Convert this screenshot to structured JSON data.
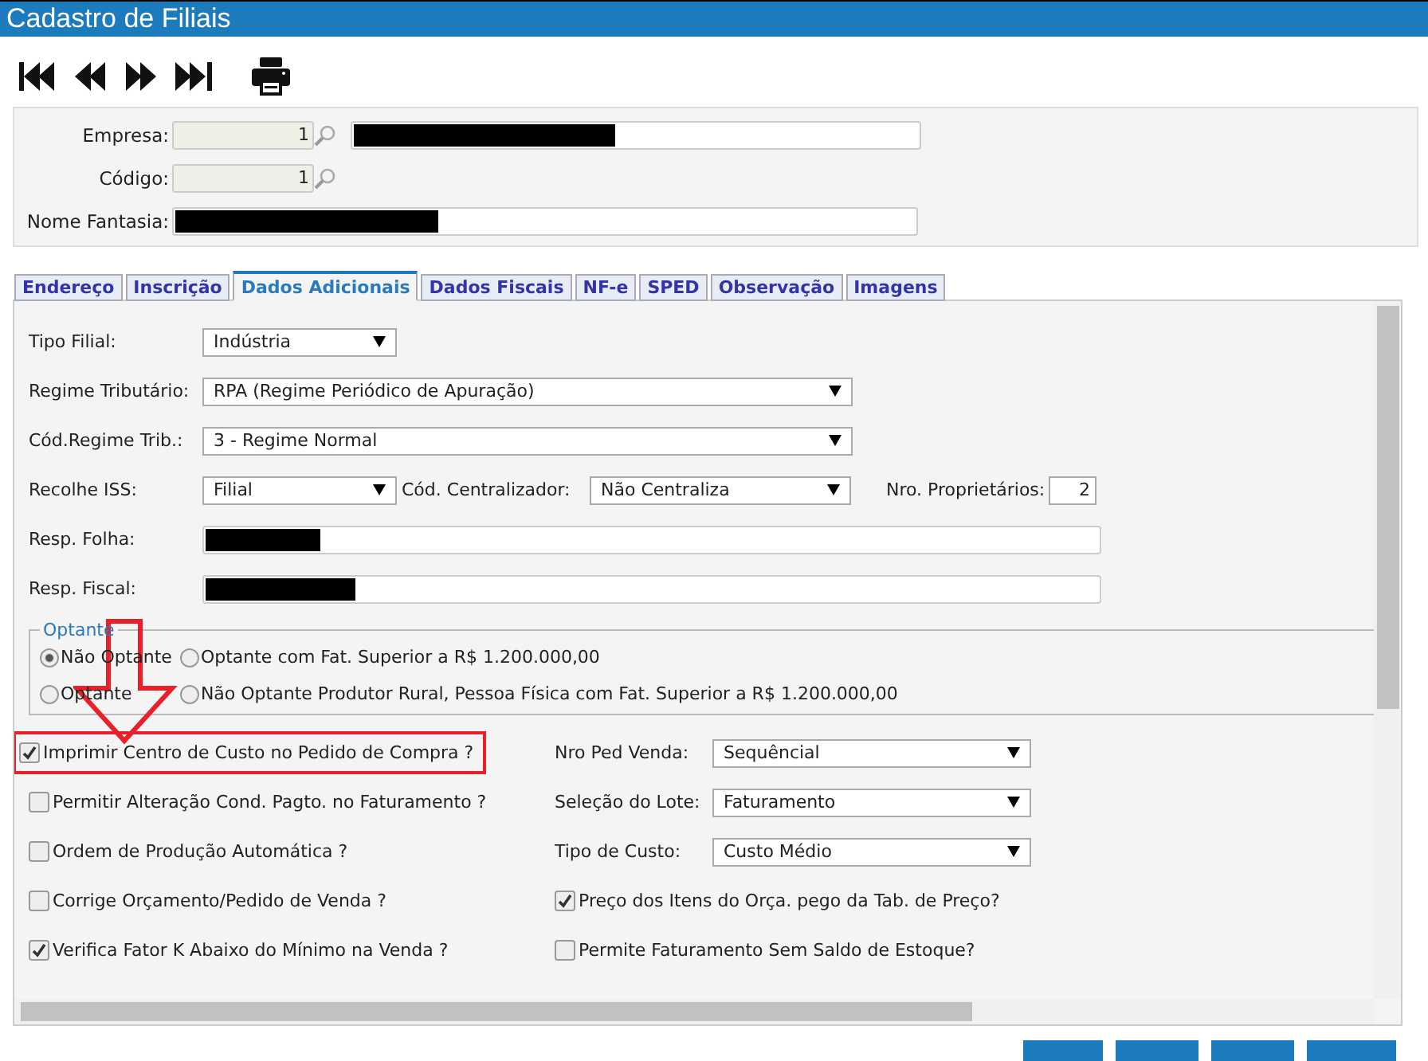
{
  "window": {
    "title": "Cadastro de Filiais"
  },
  "toolbar": [
    {
      "kind": "first"
    },
    {
      "kind": "prev"
    },
    {
      "kind": "next"
    },
    {
      "kind": "last"
    },
    {
      "kind": "print"
    }
  ],
  "header": {
    "empresa": {
      "label": "Empresa:",
      "value": "1"
    },
    "codigo": {
      "label": "Código:",
      "value": "1"
    },
    "nome_fantasia": {
      "label": "Nome Fantasia:"
    }
  },
  "tabs": [
    {
      "label": "Endereço",
      "selected": false
    },
    {
      "label": "Inscrição",
      "selected": false
    },
    {
      "label": "Dados Adicionais",
      "selected": true
    },
    {
      "label": "Dados Fiscais",
      "selected": false
    },
    {
      "label": "NF-e",
      "selected": false
    },
    {
      "label": "SPED",
      "selected": false
    },
    {
      "label": "Observação",
      "selected": false
    },
    {
      "label": "Imagens",
      "selected": false
    }
  ],
  "form": {
    "tipo_filial": {
      "label": "Tipo Filial:",
      "value": "Indústria"
    },
    "regime_tributario": {
      "label": "Regime Tributário:",
      "value": "RPA (Regime Periódico de Apuração)"
    },
    "cod_regime": {
      "label": "Cód.Regime Trib.:",
      "value": "3 - Regime Normal"
    },
    "recolhe_iss": {
      "label": "Recolhe ISS:",
      "value": "Filial"
    },
    "cod_centralizador": {
      "label": "Cód. Centralizador:",
      "value": "Não Centraliza"
    },
    "nro_proprietarios": {
      "label": "Nro. Proprietários:",
      "value": "2"
    },
    "resp_folha": {
      "label": "Resp. Folha:"
    },
    "resp_fiscal": {
      "label": "Resp. Fiscal:"
    }
  },
  "optante": {
    "legend": "Optante",
    "options": [
      {
        "label": "Não Optante",
        "selected": true
      },
      {
        "label": "Optante com Fat. Superior a R$ 1.200.000,00",
        "selected": false
      },
      {
        "label": "Optante",
        "selected": false
      },
      {
        "label": "Não Optante Produtor Rural, Pessoa Física com Fat. Superior a R$ 1.200.000,00",
        "selected": false
      }
    ]
  },
  "left_checks": [
    {
      "label": "Imprimir Centro de Custo no Pedido de Compra ?",
      "checked": true,
      "highlighted": true
    },
    {
      "label": "Permitir Alteração Cond. Pagto. no Faturamento ?",
      "checked": false,
      "highlighted": false
    },
    {
      "label": "Ordem de Produção Automática ?",
      "checked": false,
      "highlighted": false
    },
    {
      "label": "Corrige Orçamento/Pedido de Venda ?",
      "checked": false,
      "highlighted": false
    },
    {
      "label": "Verifica Fator K Abaixo do Mínimo na Venda ?",
      "checked": true,
      "highlighted": false
    }
  ],
  "right_items": [
    {
      "kind": "select",
      "label": "Nro Ped Venda:",
      "value": "Sequêncial"
    },
    {
      "kind": "select",
      "label": "Seleção do Lote:",
      "value": "Faturamento"
    },
    {
      "kind": "select",
      "label": "Tipo de Custo:",
      "value": "Custo Médio"
    },
    {
      "kind": "check",
      "label": "Preço dos Itens do Orça. pego da Tab. de Preço?",
      "checked": true
    },
    {
      "kind": "check",
      "label": "Permite Faturamento Sem Saldo de Estoque?",
      "checked": false
    }
  ]
}
